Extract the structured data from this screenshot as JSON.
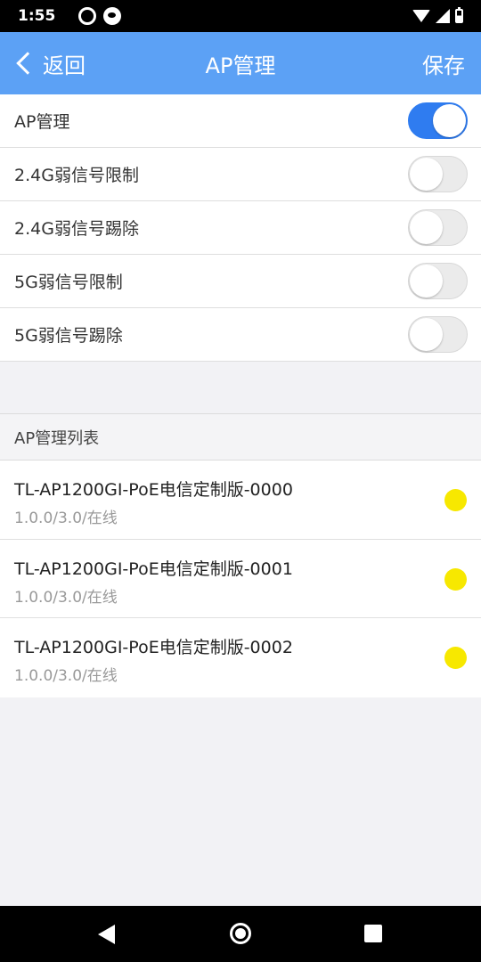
{
  "status_bar": {
    "time": "1:55",
    "icons": [
      "netease-music-icon",
      "qq-music-icon",
      "wifi-icon",
      "signal-icon",
      "battery-icon"
    ]
  },
  "header": {
    "back_label": "返回",
    "title": "AP管理",
    "save_label": "保存",
    "background_color": "#5ca1f5"
  },
  "settings": [
    {
      "label": "AP管理",
      "enabled": true
    },
    {
      "label": "2.4G弱信号限制",
      "enabled": false
    },
    {
      "label": "2.4G弱信号踢除",
      "enabled": false
    },
    {
      "label": "5G弱信号限制",
      "enabled": false
    },
    {
      "label": "5G弱信号踢除",
      "enabled": false
    }
  ],
  "ap_list": {
    "title": "AP管理列表",
    "items": [
      {
        "name": "TL-AP1200GI-PoE电信定制版-0000",
        "detail": "1.0.0/3.0/在线",
        "status_color": "#f7e800"
      },
      {
        "name": "TL-AP1200GI-PoE电信定制版-0001",
        "detail": "1.0.0/3.0/在线",
        "status_color": "#f7e800"
      },
      {
        "name": "TL-AP1200GI-PoE电信定制版-0002",
        "detail": "1.0.0/3.0/在线",
        "status_color": "#f7e800"
      }
    ]
  },
  "colors": {
    "accent": "#2f7cf0",
    "toggle_off": "#ebebeb",
    "status_online": "#f7e800"
  }
}
